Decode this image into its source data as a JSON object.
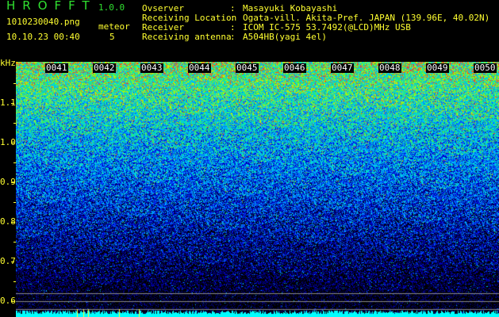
{
  "header": {
    "app_name": "HROFFT",
    "version": "1.0.0",
    "filename": "1010230040.png",
    "datetime": "10.10.23 00:40",
    "meteor_label": "meteor",
    "meteor_count": "5"
  },
  "info": [
    {
      "label": "Ovserver",
      "value": "Masayuki Kobayashi"
    },
    {
      "label": "Receiving Location",
      "value": "Ogata-vill. Akita-Pref. JAPAN (139.96E, 40.02N)"
    },
    {
      "label": "Receiver",
      "value": "ICOM IC-575 53.7492(@LCD)MHz USB"
    },
    {
      "label": "Receiving antenna",
      "value": "A504HB(yagi 4el)"
    }
  ],
  "axis": {
    "unit": "kHz",
    "y_labels": [
      "1.1",
      "1.0",
      "0.9",
      "0.8",
      "0.7",
      "0.6"
    ],
    "time_labels": [
      "0041",
      "0042",
      "0043",
      "0044",
      "0045",
      "0046",
      "0047",
      "0048",
      "0049",
      "0050"
    ]
  },
  "colors": {
    "text": "#ffff30",
    "title": "#30e030",
    "baseline": "#00ffff"
  }
}
